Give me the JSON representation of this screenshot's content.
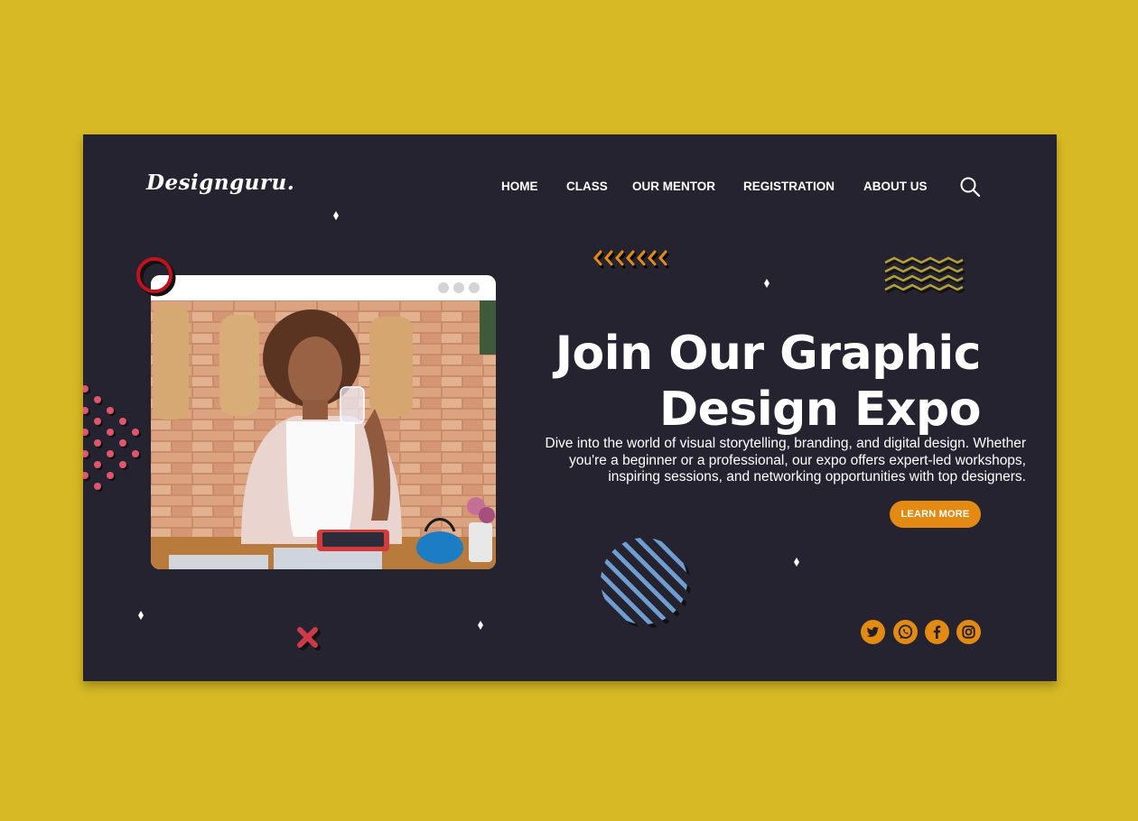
{
  "brand": {
    "logo": "Designguru."
  },
  "nav": {
    "items": [
      "HOME",
      "CLASS",
      "OUR MENTOR",
      "REGISTRATION",
      "ABOUT US"
    ],
    "search_icon": "search-icon"
  },
  "hero": {
    "title_line1": "Join Our Graphic",
    "title_line2": "Design Expo",
    "description_line1": "Dive into the world of visual storytelling, branding, and digital design. Whether",
    "description_line2": "you're a beginner or a professional, our expo offers expert-led workshops,",
    "description_line3": "inspiring sessions, and networking opportunities with top designers.",
    "cta_label": "LEARN MORE"
  },
  "social": [
    "twitter-icon",
    "whatsapp-icon",
    "facebook-icon",
    "instagram-icon"
  ],
  "colors": {
    "page_background": "#d6b924",
    "card_background": "#252330",
    "accent_orange": "#e38a12",
    "accent_pink": "#e0566f",
    "accent_red": "#c3121d",
    "accent_blue": "#6f9ed0"
  }
}
